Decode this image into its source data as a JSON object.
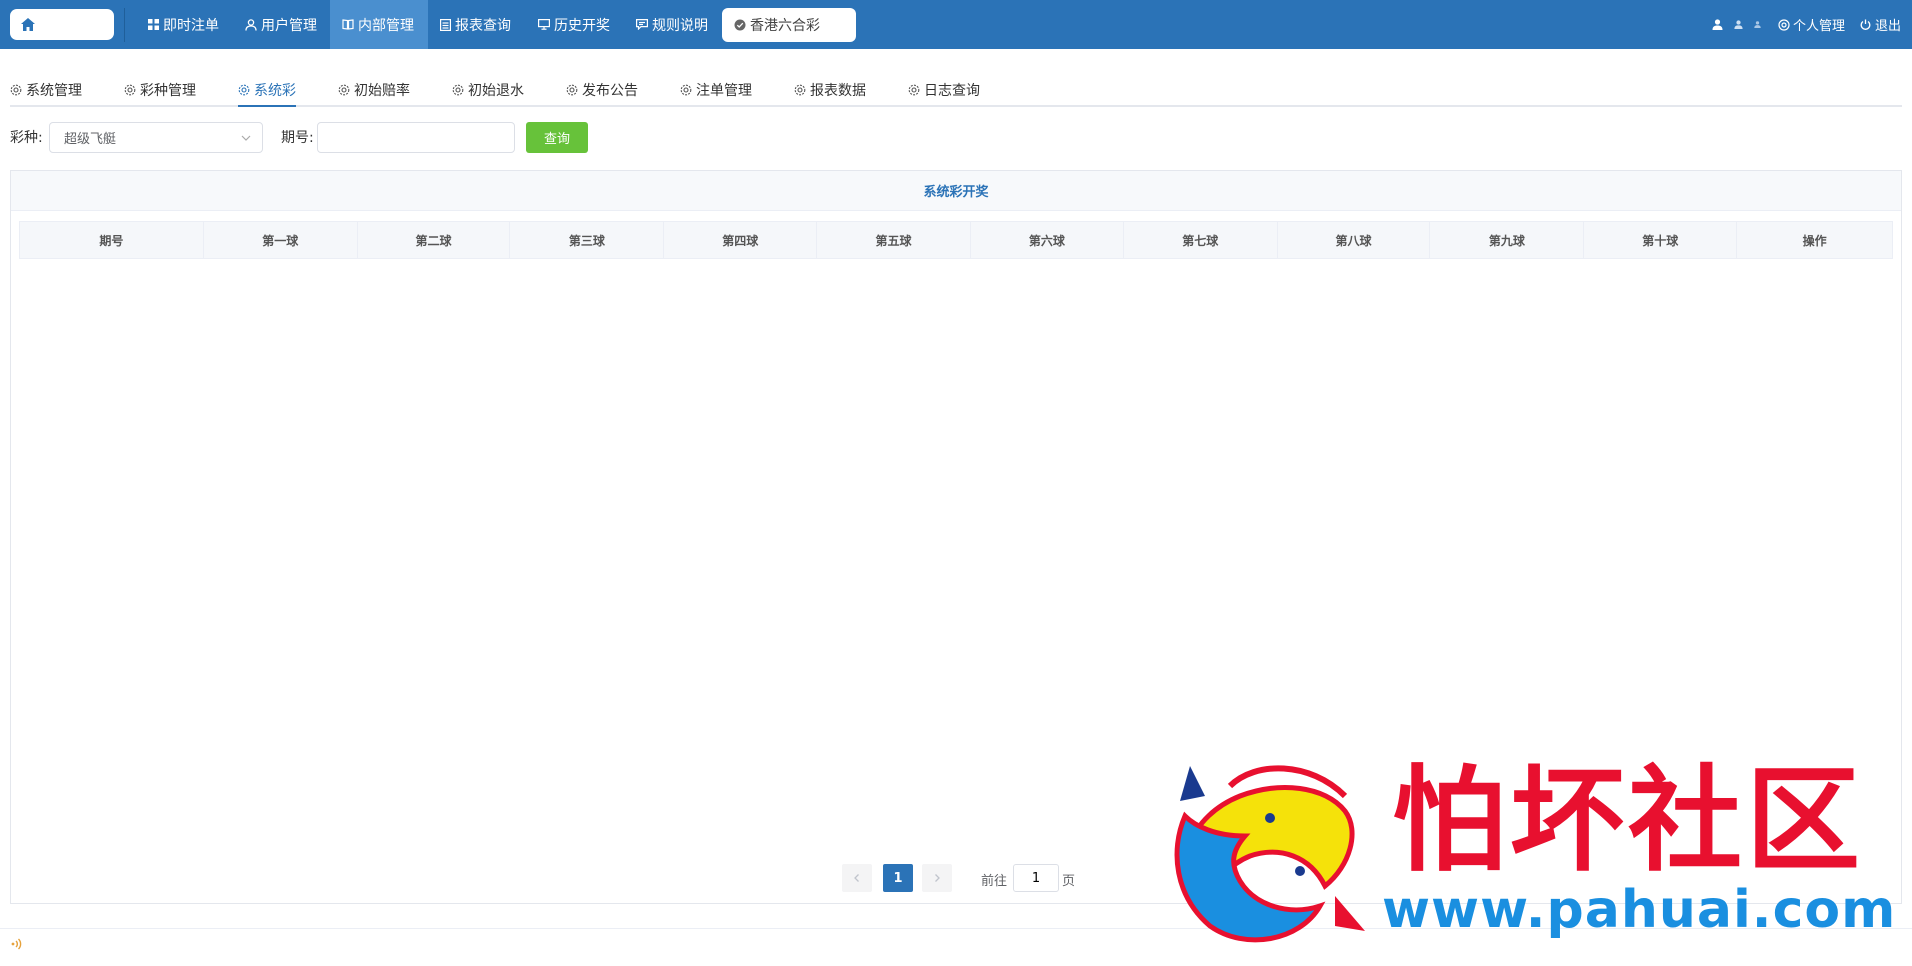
{
  "nav": {
    "items": [
      {
        "label": "即时注单",
        "icon": "grid-icon"
      },
      {
        "label": "用户管理",
        "icon": "user-icon"
      },
      {
        "label": "内部管理",
        "icon": "book-icon"
      },
      {
        "label": "报表查询",
        "icon": "report-icon"
      },
      {
        "label": "历史开奖",
        "icon": "monitor-icon"
      },
      {
        "label": "规则说明",
        "icon": "comment-icon"
      }
    ],
    "active_item": "内部管理",
    "lottery_label": "香港六合彩",
    "profile_label": "个人管理",
    "logout_label": "退出"
  },
  "subtabs": [
    {
      "label": "系统管理"
    },
    {
      "label": "彩种管理"
    },
    {
      "label": "系统彩"
    },
    {
      "label": "初始赔率"
    },
    {
      "label": "初始退水"
    },
    {
      "label": "发布公告"
    },
    {
      "label": "注单管理"
    },
    {
      "label": "报表数据"
    },
    {
      "label": "日志查询"
    }
  ],
  "active_subtab": "系统彩",
  "filter": {
    "lottery_label": "彩种:",
    "lottery_value": "超级飞艇",
    "issue_label": "期号:",
    "issue_value": "",
    "query_label": "查询"
  },
  "panel": {
    "title": "系统彩开奖",
    "columns": [
      "期号",
      "第一球",
      "第二球",
      "第三球",
      "第四球",
      "第五球",
      "第六球",
      "第七球",
      "第八球",
      "第九球",
      "第十球",
      "操作"
    ]
  },
  "pagination": {
    "current_page": "1",
    "goto_prefix": "前往",
    "goto_value": "1",
    "goto_suffix": "页"
  },
  "watermark": {
    "text": "怕坏社区",
    "url": "www.pahuai.com"
  },
  "colors": {
    "primary": "#2b73b7",
    "success": "#67c23a"
  }
}
